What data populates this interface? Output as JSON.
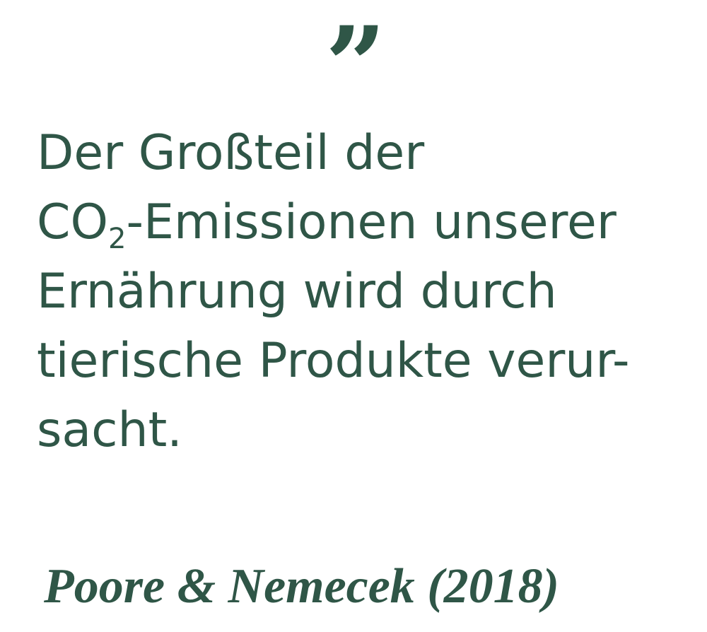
{
  "quote": {
    "mark": "”",
    "lines": {
      "line1": "Der Großteil der",
      "line2_prefix": "CO",
      "line2_subscript": "2",
      "line2_suffix": "-Emissionen unserer",
      "line3": "Ernährung wird durch",
      "line4": "tierische Produkte verur-",
      "line5": "sacht."
    }
  },
  "citation": {
    "text": "Poore & Nemecek (2018)"
  },
  "colors": {
    "text": "#2f5647",
    "background": "#ffffff"
  }
}
